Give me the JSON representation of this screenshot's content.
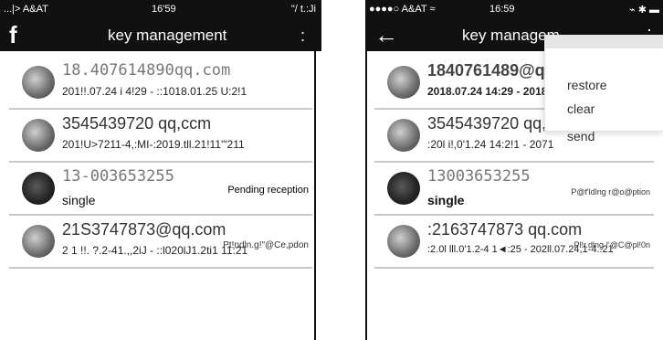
{
  "left": {
    "status": {
      "left": "...|> A&AT",
      "time": "16'59",
      "right": "\"/ t.:Ji"
    },
    "nav": {
      "left_icon": "f",
      "title": "key management",
      "right_icon": ":"
    },
    "rows": [
      {
        "name": "18.407614890qq.com",
        "sub": "201!!.07.24 i 4!29 - ::1018.01.25 U:2!1",
        "status": ""
      },
      {
        "name": "3545439720 qq,ccm",
        "sub": "201!U>7211-4,:MI-:2019.tll.21!11'\"211",
        "status": ""
      },
      {
        "name": "13-003653255",
        "sub": "single",
        "status": "Pending reception"
      },
      {
        "name": "21S3747873@qq.com",
        "sub": "2 1 !!. ?.2-41.,,2iJ - ::l020lJ1.2ti1 11:21",
        "status": "Pt!ndln.g!\"@Ce,pdon"
      }
    ]
  },
  "right": {
    "status": {
      "left": "●●●●○ A&AT ≈",
      "time": "16:59",
      "right": "⌁ ✱ ▬"
    },
    "nav": {
      "left_icon": "←",
      "title": "key managem",
      "right_icon": "⋮"
    },
    "rows": [
      {
        "name": "1840761489@qq.c",
        "sub": "2018.07.24 14:29 - 2018",
        "status": ""
      },
      {
        "name": "3545439720  qq,c",
        "sub": ":20l i!,0'1.24 14:2!1 - 2071",
        "status": ""
      },
      {
        "name": "13003653255",
        "sub": "single",
        "status": "P@f'ldlng r@o@ption"
      },
      {
        "name": ":2163747873  qq.com",
        "sub": ":2.0l lll.0'1.2-4 1◄:25 - 202ll.07.24,1-4.:21",
        "status": "Pl!r.dlng !'@C@pl!0n"
      }
    ],
    "menu": {
      "items": [
        "restore",
        "clear",
        "send"
      ]
    }
  }
}
